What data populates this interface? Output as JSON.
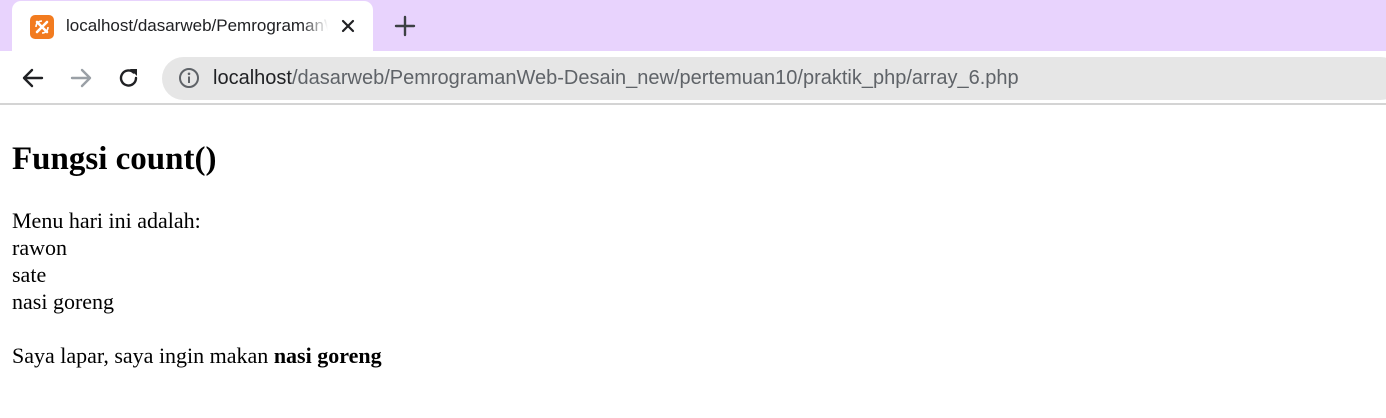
{
  "browser": {
    "tab": {
      "title": "localhost/dasarweb/PemrogramanWeb-Desain_new/pertemuan10/praktik_php/array_6.php",
      "favicon": "xampp-icon",
      "close_icon": "close-icon"
    },
    "new_tab_icon": "plus-icon",
    "nav": {
      "back_icon": "back-arrow-icon",
      "forward_icon": "forward-arrow-icon",
      "reload_icon": "reload-icon"
    },
    "address_bar": {
      "info_icon": "info-icon",
      "host": "localhost",
      "path": "/dasarweb/PemrogramanWeb-Desain_new/pertemuan10/praktik_php/array_6.php"
    },
    "colors": {
      "tabstrip_bg": "#e8d3fd",
      "favicon_orange": "#f27b1f",
      "omnibox_bg": "#e6e6e6"
    }
  },
  "page": {
    "heading": "Fungsi count()",
    "intro": "Menu hari ini adalah:",
    "menu_items": [
      "rawon",
      "sate",
      "nasi goreng"
    ],
    "sentence_prefix": "Saya lapar, saya ingin makan ",
    "sentence_bold": "nasi goreng"
  }
}
